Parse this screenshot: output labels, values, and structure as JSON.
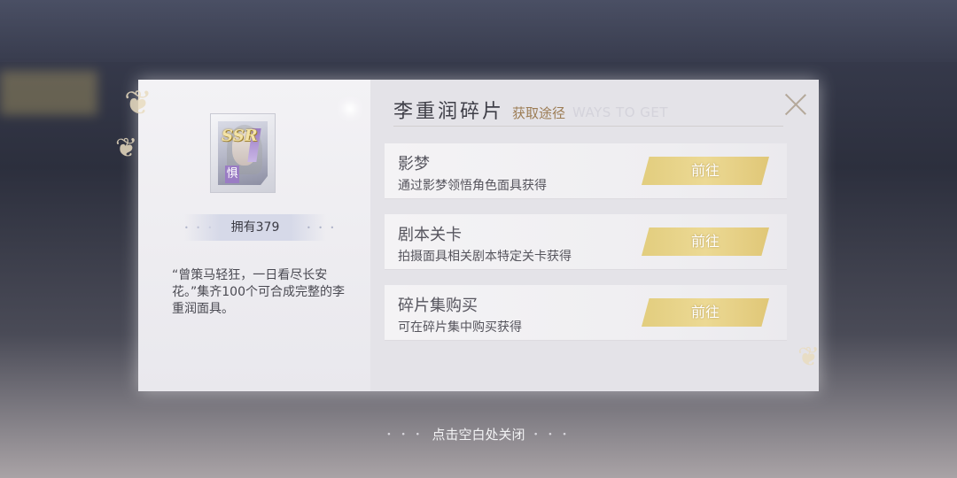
{
  "item": {
    "rarity": "SSR",
    "tag": "惧",
    "owned_label": "拥有379",
    "description": "“曾策马轻狂，一日看尽长安花。”集齐100个可合成完整的李重润面具。"
  },
  "header": {
    "title": "李重润碎片",
    "subtitle_cn": "获取途径",
    "subtitle_en": "WAYS TO GET"
  },
  "sources": [
    {
      "title": "影梦",
      "desc": "通过影梦领悟角色面具获得",
      "button": "前往"
    },
    {
      "title": "剧本关卡",
      "desc": "拍摄面具相关剧本特定关卡获得",
      "button": "前往"
    },
    {
      "title": "碎片集购买",
      "desc": "可在碎片集中购买获得",
      "button": "前往"
    }
  ],
  "footer": {
    "hint": "点击空白处关闭"
  },
  "colors": {
    "accent_gold": "#e6d187",
    "title_brown": "#9c7c54"
  }
}
